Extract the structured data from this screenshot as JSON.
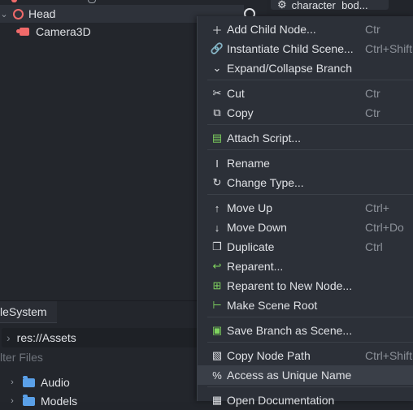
{
  "scene_tree": {
    "head_label": "Head",
    "camera_label": "Camera3D"
  },
  "inspector": {
    "tab_label": "character_bod..."
  },
  "filesystem": {
    "tab_label": "leSystem",
    "path": "res://Assets",
    "filter_placeholder": "lter Files",
    "items": [
      "Audio",
      "Models"
    ]
  },
  "context_menu": {
    "items": [
      {
        "label": "Add Child Node...",
        "shortcut": "Ctr",
        "icon": "plus-icon"
      },
      {
        "label": "Instantiate Child Scene...",
        "shortcut": "Ctrl+Shift",
        "icon": "link-icon"
      },
      {
        "label": "Expand/Collapse Branch",
        "shortcut": "",
        "icon": "chevron-down-icon"
      },
      {
        "label": "Cut",
        "shortcut": "Ctr",
        "icon": "scissors-icon"
      },
      {
        "label": "Copy",
        "shortcut": "Ctr",
        "icon": "copy-icon"
      },
      {
        "label": "Attach Script...",
        "shortcut": "",
        "icon": "script-icon"
      },
      {
        "label": "Rename",
        "shortcut": "",
        "icon": "rename-icon"
      },
      {
        "label": "Change Type...",
        "shortcut": "",
        "icon": "change-type-icon"
      },
      {
        "label": "Move Up",
        "shortcut": "Ctrl+",
        "icon": "arrow-up-icon"
      },
      {
        "label": "Move Down",
        "shortcut": "Ctrl+Do",
        "icon": "arrow-down-icon"
      },
      {
        "label": "Duplicate",
        "shortcut": "Ctrl",
        "icon": "duplicate-icon"
      },
      {
        "label": "Reparent...",
        "shortcut": "",
        "icon": "reparent-icon"
      },
      {
        "label": "Reparent to New Node...",
        "shortcut": "",
        "icon": "reparent-new-icon"
      },
      {
        "label": "Make Scene Root",
        "shortcut": "",
        "icon": "scene-root-icon"
      },
      {
        "label": "Save Branch as Scene...",
        "shortcut": "",
        "icon": "save-branch-icon"
      },
      {
        "label": "Copy Node Path",
        "shortcut": "Ctrl+Shift",
        "icon": "node-path-icon"
      },
      {
        "label": "Access as Unique Name",
        "shortcut": "",
        "icon": "percent-icon"
      },
      {
        "label": "Open Documentation",
        "shortcut": "",
        "icon": "docs-icon"
      }
    ]
  }
}
